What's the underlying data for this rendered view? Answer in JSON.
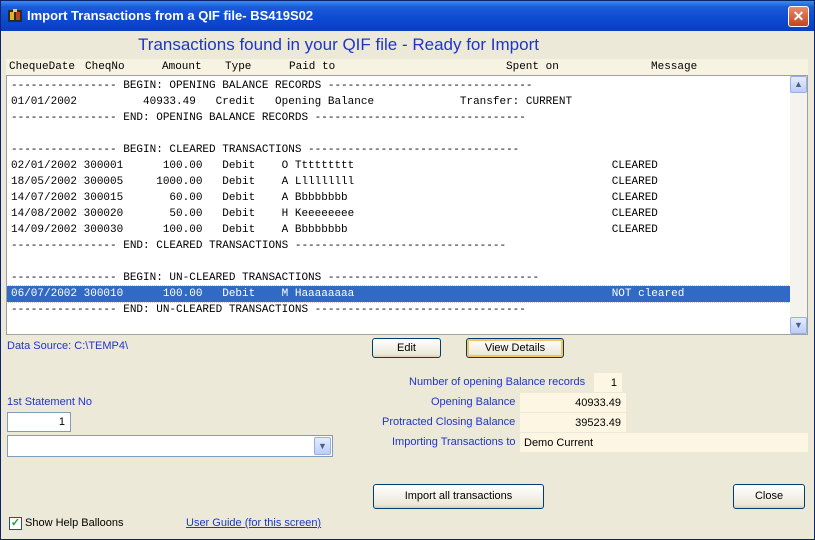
{
  "window": {
    "title": "Import Transactions from a QIF file- BS419S02",
    "close_glyph": "✕"
  },
  "heading": "Transactions found in your QIF file - Ready for Import",
  "columns": {
    "cheque_date": "ChequeDate",
    "cheq_no": "CheqNo",
    "amount": "Amount",
    "type": "Type",
    "paid_to": "Paid to",
    "spent_on": "Spent on",
    "message": "Message"
  },
  "lines": [
    "---------------- BEGIN: OPENING BALANCE RECORDS -------------------------------",
    "01/01/2002          40933.49   Credit   Opening Balance             Transfer: CURRENT",
    "---------------- END: OPENING BALANCE RECORDS --------------------------------",
    "",
    "---------------- BEGIN: CLEARED TRANSACTIONS --------------------------------",
    "02/01/2002 300001      100.00   Debit    O Ttttttttt                                       CLEARED",
    "18/05/2002 300005     1000.00   Debit    A Lllllllll                                       CLEARED",
    "14/07/2002 300015       60.00   Debit    A Bbbbbbbb                                        CLEARED",
    "14/08/2002 300020       50.00   Debit    H Keeeeeeee                                       CLEARED",
    "14/09/2002 300030      100.00   Debit    A Bbbbbbbb                                        CLEARED",
    "---------------- END: CLEARED TRANSACTIONS --------------------------------",
    "",
    "---------------- BEGIN: UN-CLEARED TRANSACTIONS --------------------------------",
    "06/07/2002 300010      100.00   Debit    M Haaaaaaaa                                       NOT cleared",
    "---------------- END: UN-CLEARED TRANSACTIONS --------------------------------"
  ],
  "selected_line_index": 13,
  "data_source": "Data Source: C:\\TEMP4\\",
  "buttons": {
    "edit": "Edit",
    "view_details": "View Details",
    "import_all": "Import all transactions",
    "close": "Close"
  },
  "statement": {
    "label": "1st Statement No",
    "value": "1"
  },
  "summary": {
    "opening_records_label": "Number of opening Balance records",
    "opening_records_value": "1",
    "opening_balance_label": "Opening Balance",
    "opening_balance_value": "40933.49",
    "closing_balance_label": "Protracted Closing Balance",
    "closing_balance_value": "39523.49",
    "importing_to_label": "Importing Transactions to",
    "importing_to_value": "Demo Current"
  },
  "help_balloons": {
    "label": "Show Help Balloons",
    "checked": true
  },
  "user_guide_link": "User Guide (for this screen)",
  "icons": {
    "scroll_up": "▲",
    "scroll_down": "▼",
    "dropdown": "▼",
    "check": "✓"
  }
}
